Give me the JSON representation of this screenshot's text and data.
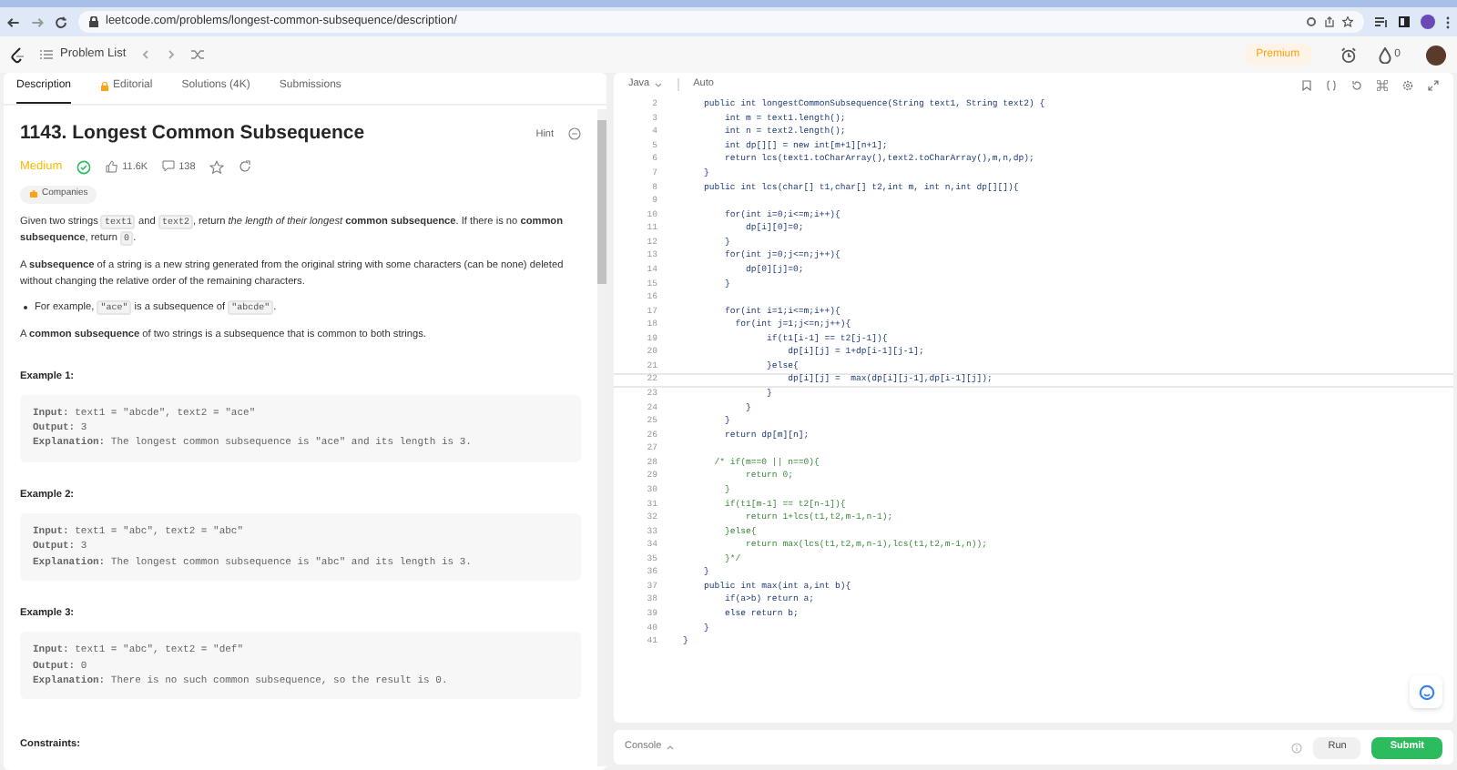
{
  "browser": {
    "url": "leetcode.com/problems/longest-common-subsequence/description/"
  },
  "nav": {
    "problem_list": "Problem List",
    "premium": "Premium",
    "streak": "0"
  },
  "left_tabs": [
    {
      "label": "Description",
      "selected": true,
      "locked": false
    },
    {
      "label": "Editorial",
      "selected": false,
      "locked": true
    },
    {
      "label": "Solutions (4K)",
      "selected": false,
      "locked": false
    },
    {
      "label": "Submissions",
      "selected": false,
      "locked": false
    }
  ],
  "problem": {
    "title": "1143. Longest Common Subsequence",
    "hint": "Hint",
    "difficulty": "Medium",
    "solved": true,
    "likes": "11.6K",
    "dislikes": "138",
    "companies": "Companies",
    "paragraphs": [
      {
        "kind": "para",
        "segments": [
          {
            "kind": "text",
            "text": "Given two strings "
          },
          {
            "kind": "code",
            "text": "text1"
          },
          {
            "kind": "text",
            "text": " and "
          },
          {
            "kind": "code",
            "text": "text2"
          },
          {
            "kind": "text",
            "text": ", return *the length of their longest* **common subsequence**. If there is no **common subsequence**, return "
          },
          {
            "kind": "code",
            "text": "0"
          },
          {
            "kind": "text",
            "text": "."
          }
        ]
      },
      {
        "kind": "para",
        "segments": [
          {
            "kind": "text",
            "text": "A **subsequence** of a string is a new string generated from the original string with some characters (can be none) deleted without changing the relative order of the remaining characters."
          }
        ]
      },
      {
        "kind": "bullet",
        "segments": [
          {
            "kind": "text",
            "text": "For example, "
          },
          {
            "kind": "code",
            "text": "\"ace\""
          },
          {
            "kind": "text",
            "text": " is a subsequence of "
          },
          {
            "kind": "code",
            "text": "\"abcde\""
          },
          {
            "kind": "text",
            "text": "."
          }
        ]
      },
      {
        "kind": "para",
        "segments": [
          {
            "kind": "text",
            "text": "A **common subsequence** of two strings is a subsequence that is common to both strings."
          }
        ]
      }
    ],
    "examples": [
      {
        "title": "Example 1:",
        "lines": [
          "**Input:** text1 = \"abcde\", text2 = \"ace\"",
          "**Output:** 3",
          "**Explanation:** The longest common subsequence is \"ace\" and its length is 3."
        ]
      },
      {
        "title": "Example 2:",
        "lines": [
          "**Input:** text1 = \"abc\", text2 = \"abc\"",
          "**Output:** 3",
          "**Explanation:** The longest common subsequence is \"abc\" and its length is 3."
        ]
      },
      {
        "title": "Example 3:",
        "lines": [
          "**Input:** text1 = \"abc\", text2 = \"def\"",
          "**Output:** 0",
          "**Explanation:** There is no such common subsequence, so the result is 0."
        ]
      }
    ],
    "constraints": "Constraints:"
  },
  "editor": {
    "language": "Java",
    "mode": "Auto",
    "lines": [
      {
        "number": "2",
        "text": "    public int longestCommonSubsequence(String text1, String text2) {",
        "kind": "code",
        "selected": false
      },
      {
        "number": "3",
        "text": "        int m = text1.length();",
        "kind": "code",
        "selected": false
      },
      {
        "number": "4",
        "text": "        int n = text2.length();",
        "kind": "code",
        "selected": false
      },
      {
        "number": "5",
        "text": "        int dp[][] = new int[m+1][n+1];",
        "kind": "code",
        "selected": false
      },
      {
        "number": "6",
        "text": "        return lcs(text1.toCharArray(),text2.toCharArray(),m,n,dp);",
        "kind": "code",
        "selected": false
      },
      {
        "number": "7",
        "text": "    }",
        "kind": "code",
        "selected": false
      },
      {
        "number": "8",
        "text": "    public int lcs(char[] t1,char[] t2,int m, int n,int dp[][]){",
        "kind": "code",
        "selected": false
      },
      {
        "number": "9",
        "selected": false
      },
      {
        "number": "10",
        "text": "        for(int i=0;i<=m;i++){",
        "kind": "code",
        "selected": false
      },
      {
        "number": "11",
        "text": "            dp[i][0]=0;",
        "kind": "code",
        "selected": false
      },
      {
        "number": "12",
        "text": "        }",
        "kind": "code",
        "selected": false
      },
      {
        "number": "13",
        "text": "        for(int j=0;j<=n;j++){",
        "kind": "code",
        "selected": false
      },
      {
        "number": "14",
        "text": "            dp[0][j]=0;",
        "kind": "code",
        "selected": false
      },
      {
        "number": "15",
        "text": "        }",
        "kind": "code",
        "selected": false
      },
      {
        "number": "16",
        "selected": false
      },
      {
        "number": "17",
        "text": "        for(int i=1;i<=m;i++){",
        "kind": "code",
        "selected": false
      },
      {
        "number": "18",
        "text": "          for(int j=1;j<=n;j++){",
        "kind": "code",
        "selected": false
      },
      {
        "number": "19",
        "text": "                if(t1[i-1] == t2[j-1]){",
        "kind": "code",
        "selected": false
      },
      {
        "number": "20",
        "text": "                    dp[i][j] = 1+dp[i-1][j-1];",
        "kind": "code",
        "selected": false
      },
      {
        "number": "21",
        "text": "                }else{",
        "kind": "code",
        "selected": false
      },
      {
        "number": "22",
        "text": "                    dp[i][j] =  max(dp[i][j-1],dp[i-1][j]);",
        "kind": "code",
        "selected": true
      },
      {
        "number": "23",
        "text": "                }",
        "kind": "code",
        "selected": false
      },
      {
        "number": "24",
        "text": "            }",
        "kind": "code",
        "selected": false
      },
      {
        "number": "25",
        "text": "        }",
        "kind": "code",
        "selected": false
      },
      {
        "number": "26",
        "text": "        return dp[m][n];",
        "kind": "code",
        "selected": false
      },
      {
        "number": "27",
        "selected": false
      },
      {
        "number": "28",
        "text": "      /* if(m==0 || n==0){",
        "kind": "comment",
        "selected": false
      },
      {
        "number": "29",
        "text": "            return 0;",
        "kind": "comment",
        "selected": false
      },
      {
        "number": "30",
        "text": "        }",
        "kind": "comment",
        "selected": false
      },
      {
        "number": "31",
        "text": "        if(t1[m-1] == t2[n-1]){",
        "kind": "comment",
        "selected": false
      },
      {
        "number": "32",
        "text": "            return 1+lcs(t1,t2,m-1,n-1);",
        "kind": "comment",
        "selected": false
      },
      {
        "number": "33",
        "text": "        }else{",
        "kind": "comment",
        "selected": false
      },
      {
        "number": "34",
        "text": "            return max(lcs(t1,t2,m,n-1),lcs(t1,t2,m-1,n));",
        "kind": "comment",
        "selected": false
      },
      {
        "number": "35",
        "text": "        }*/",
        "kind": "comment",
        "selected": false
      },
      {
        "number": "36",
        "text": "    }",
        "kind": "code",
        "selected": false
      },
      {
        "number": "37",
        "text": "    public int max(int a,int b){",
        "kind": "code",
        "selected": false
      },
      {
        "number": "38",
        "text": "        if(a>b) return a;",
        "kind": "code",
        "selected": false
      },
      {
        "number": "39",
        "text": "        else return b;",
        "kind": "code",
        "selected": false
      },
      {
        "number": "40",
        "text": "    }",
        "kind": "code",
        "selected": false
      },
      {
        "number": "41",
        "text": "}",
        "kind": "code",
        "selected": false
      }
    ]
  },
  "footer": {
    "console": "Console",
    "run": "Run",
    "submit": "Submit"
  }
}
